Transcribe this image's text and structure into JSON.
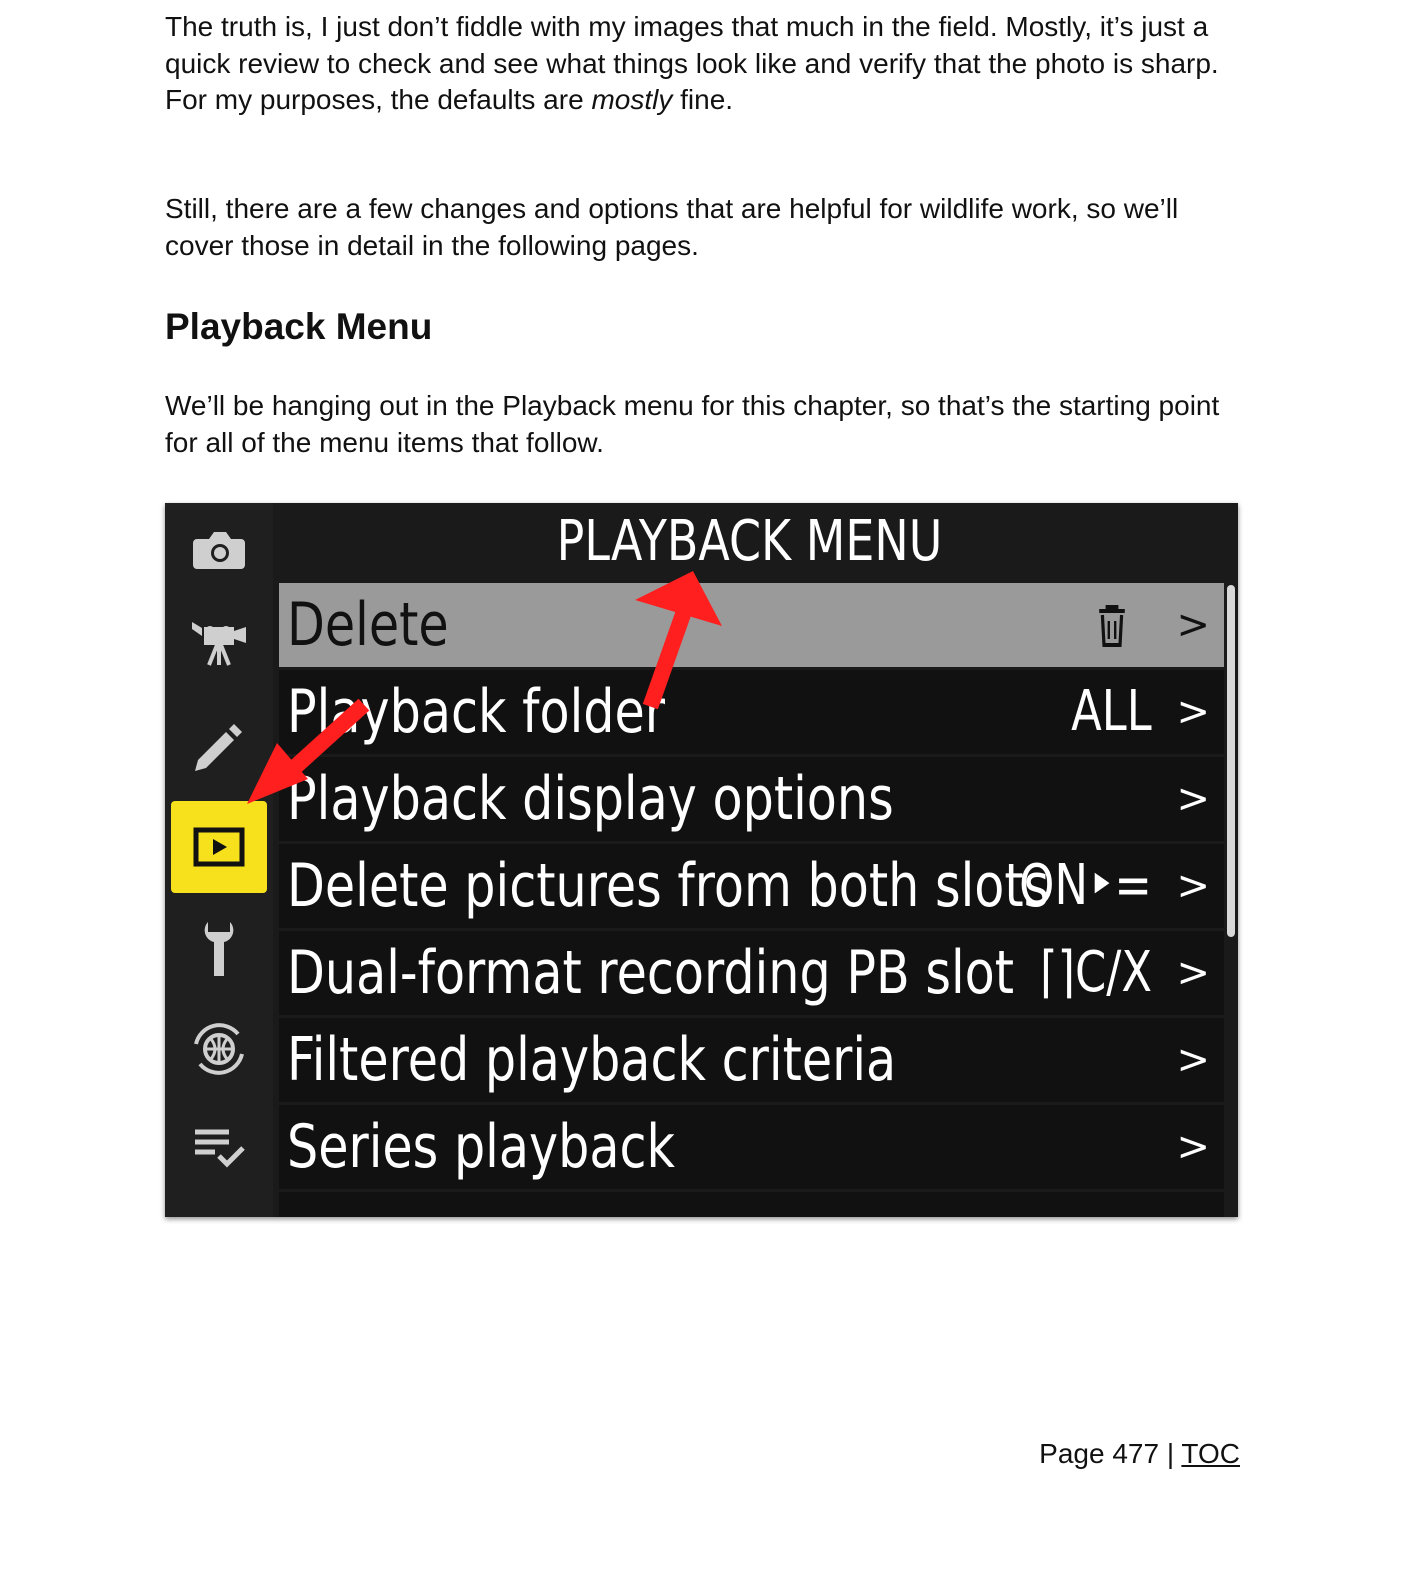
{
  "paragraphs": {
    "p1_before": "The truth is, I just don’t fiddle with my images that much in the field. Mostly, it’s just a quick review to check and see what things look like and verify that the photo is sharp. For my purposes, the defaults are ",
    "p1_emphasis": "mostly",
    "p1_after": " fine.",
    "p2": "Still, there are a few changes and options that are helpful for wildlife work, so we’ll cover those in detail in the following pages.",
    "p3": "We’ll be hanging out in the Playback menu for this chapter, so that’s the starting point for all of the menu items that follow."
  },
  "heading": "Playback Menu",
  "camera_menu": {
    "title": "PLAYBACK MENU",
    "sidebar_icons": [
      "camera-icon",
      "movie-camera-icon",
      "pencil-icon",
      "playback-icon",
      "wrench-icon",
      "network-icon",
      "my-menu-icon"
    ],
    "active_tab": "playback-icon",
    "accent_color": "#f7e01c",
    "arrow_color": "#ff1f1f",
    "rows": [
      {
        "label": "Delete",
        "value": "",
        "value_icon": "trash-icon",
        "chevron": ">"
      },
      {
        "label": "Playback folder",
        "value": "ALL",
        "chevron": ">"
      },
      {
        "label": "Playback display options",
        "value": "",
        "chevron": ">"
      },
      {
        "label": "Delete pictures from both slots",
        "value": "ON‣=",
        "chevron": ">"
      },
      {
        "label": "Dual-format recording PB slot",
        "value": "⌈⌉C/X",
        "chevron": ">"
      },
      {
        "label": "Filtered playback criteria",
        "value": "",
        "chevron": ">"
      },
      {
        "label": "Series playback",
        "value": "",
        "chevron": ">"
      }
    ]
  },
  "footer": {
    "page_label": "Page 477 | ",
    "toc_link": "TOC"
  }
}
